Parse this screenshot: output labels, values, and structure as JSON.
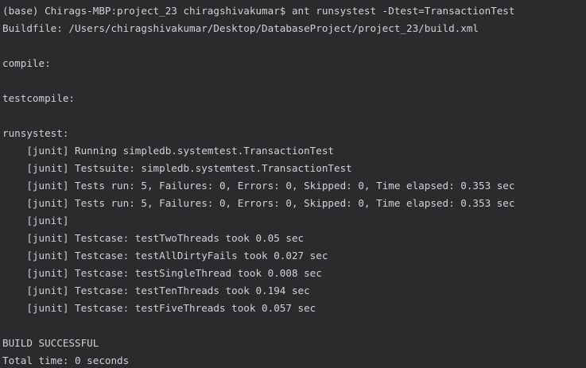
{
  "terminal": {
    "lines": [
      "(base) Chirags-MBP:project_23 chiragshivakumar$ ant runsystest -Dtest=TransactionTest",
      "Buildfile: /Users/chiragshivakumar/Desktop/DatabaseProject/project_23/build.xml",
      "",
      "compile:",
      "",
      "testcompile:",
      "",
      "runsystest:",
      "    [junit] Running simpledb.systemtest.TransactionTest",
      "    [junit] Testsuite: simpledb.systemtest.TransactionTest",
      "    [junit] Tests run: 5, Failures: 0, Errors: 0, Skipped: 0, Time elapsed: 0.353 sec",
      "    [junit] Tests run: 5, Failures: 0, Errors: 0, Skipped: 0, Time elapsed: 0.353 sec",
      "    [junit]",
      "    [junit] Testcase: testTwoThreads took 0.05 sec",
      "    [junit] Testcase: testAllDirtyFails took 0.027 sec",
      "    [junit] Testcase: testSingleThread took 0.008 sec",
      "    [junit] Testcase: testTenThreads took 0.194 sec",
      "    [junit] Testcase: testFiveThreads took 0.057 sec",
      "",
      "BUILD SUCCESSFUL",
      "Total time: 0 seconds"
    ]
  },
  "colors": {
    "background": "#2b2b2d",
    "text": "#cfd2d6"
  }
}
